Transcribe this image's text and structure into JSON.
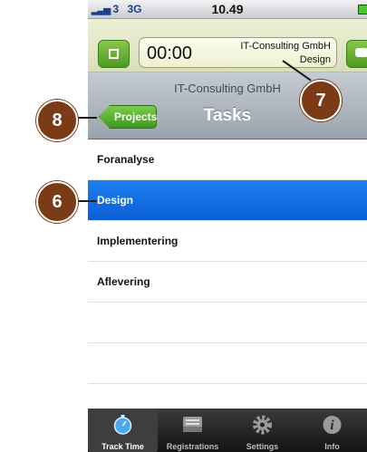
{
  "status_bar": {
    "carrier": "3",
    "network": "3G",
    "time": "10.49"
  },
  "timer": {
    "elapsed": "00:00",
    "company": "IT-Consulting GmbH",
    "task": "Design"
  },
  "nav": {
    "subtitle": "IT-Consulting GmbH",
    "title": "Tasks",
    "back_label": "Projects"
  },
  "tasks": [
    "Foranalyse",
    "Design",
    "Implementering",
    "Aflevering"
  ],
  "selected_task": "Design",
  "tabs": [
    {
      "label": "Track Time",
      "icon": "stopwatch-icon",
      "active": true
    },
    {
      "label": "Registrations",
      "icon": "inbox-icon",
      "active": false
    },
    {
      "label": "Settings",
      "icon": "gear-icon",
      "active": false
    },
    {
      "label": "Info",
      "icon": "info-icon",
      "active": false
    }
  ],
  "callouts": [
    "8",
    "7",
    "6"
  ],
  "colors": {
    "accent_green": "#4f9b22",
    "selection_blue": "#0a5fd6",
    "callout_brown": "#7a3b16"
  }
}
